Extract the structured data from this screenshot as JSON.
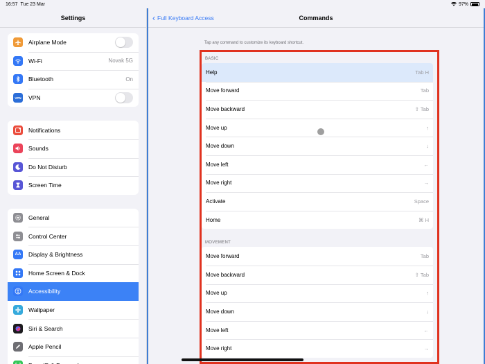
{
  "status": {
    "time": "16:57",
    "date": "Tue 23 Mar",
    "battery": "97%"
  },
  "sidebar": {
    "title": "Settings",
    "groups": [
      [
        {
          "label": "Airplane Mode",
          "icon": "airplane-icon",
          "color": "#f09a37",
          "toggle": "off"
        },
        {
          "label": "Wi-Fi",
          "icon": "wifi-icon",
          "color": "#3478f6",
          "value": "Novak 5G"
        },
        {
          "label": "Bluetooth",
          "icon": "bluetooth-icon",
          "color": "#3478f6",
          "value": "On"
        },
        {
          "label": "VPN",
          "icon": "vpn-icon",
          "color": "#2c6ed8",
          "icon_text": "VPN",
          "toggle": "off"
        }
      ],
      [
        {
          "label": "Notifications",
          "icon": "notifications-icon",
          "color": "#eb4d3d"
        },
        {
          "label": "Sounds",
          "icon": "sounds-icon",
          "color": "#eb445a"
        },
        {
          "label": "Do Not Disturb",
          "icon": "moon-icon",
          "color": "#5856d6"
        },
        {
          "label": "Screen Time",
          "icon": "hourglass-icon",
          "color": "#5856d6"
        }
      ],
      [
        {
          "label": "General",
          "icon": "gear-icon",
          "color": "#8e8e93"
        },
        {
          "label": "Control Center",
          "icon": "control-center-icon",
          "color": "#8e8e93"
        },
        {
          "label": "Display & Brightness",
          "icon": "display-icon",
          "color": "#3478f6",
          "icon_text": "AA"
        },
        {
          "label": "Home Screen & Dock",
          "icon": "home-screen-icon",
          "color": "#3478f6"
        },
        {
          "label": "Accessibility",
          "icon": "accessibility-icon",
          "color": "#3478f6",
          "active": true
        },
        {
          "label": "Wallpaper",
          "icon": "wallpaper-icon",
          "color": "#36aadc"
        },
        {
          "label": "Siri & Search",
          "icon": "siri-icon",
          "color": "#1c1c1e"
        },
        {
          "label": "Apple Pencil",
          "icon": "pencil-icon",
          "color": "#6e6e73"
        },
        {
          "label": "Face ID & Passcode",
          "icon": "faceid-icon",
          "color": "#34c759"
        }
      ]
    ]
  },
  "main": {
    "back_label": "Full Keyboard Access",
    "title": "Commands",
    "hint": "Tap any command to customize its keyboard shortcut.",
    "sections": [
      {
        "header": "BASIC",
        "rows": [
          {
            "label": "Help",
            "key": "Tab H",
            "selected": true
          },
          {
            "label": "Move forward",
            "key": "Tab"
          },
          {
            "label": "Move backward",
            "key": "⇧ Tab"
          },
          {
            "label": "Move up",
            "key": "↑"
          },
          {
            "label": "Move down",
            "key": "↓"
          },
          {
            "label": "Move left",
            "key": "←"
          },
          {
            "label": "Move right",
            "key": "→"
          },
          {
            "label": "Activate",
            "key": "Space"
          },
          {
            "label": "Home",
            "key": "⌘ H"
          }
        ]
      },
      {
        "header": "MOVEMENT",
        "rows": [
          {
            "label": "Move forward",
            "key": "Tab"
          },
          {
            "label": "Move backward",
            "key": "⇧ Tab"
          },
          {
            "label": "Move up",
            "key": "↑"
          },
          {
            "label": "Move down",
            "key": "↓"
          },
          {
            "label": "Move left",
            "key": "←"
          },
          {
            "label": "Move right",
            "key": "→"
          }
        ]
      }
    ]
  },
  "colors": {
    "accent": "#3478f6",
    "active_row": "#3c82f6",
    "highlight_border": "#e0321f",
    "focus_border": "#3f7dd3"
  }
}
